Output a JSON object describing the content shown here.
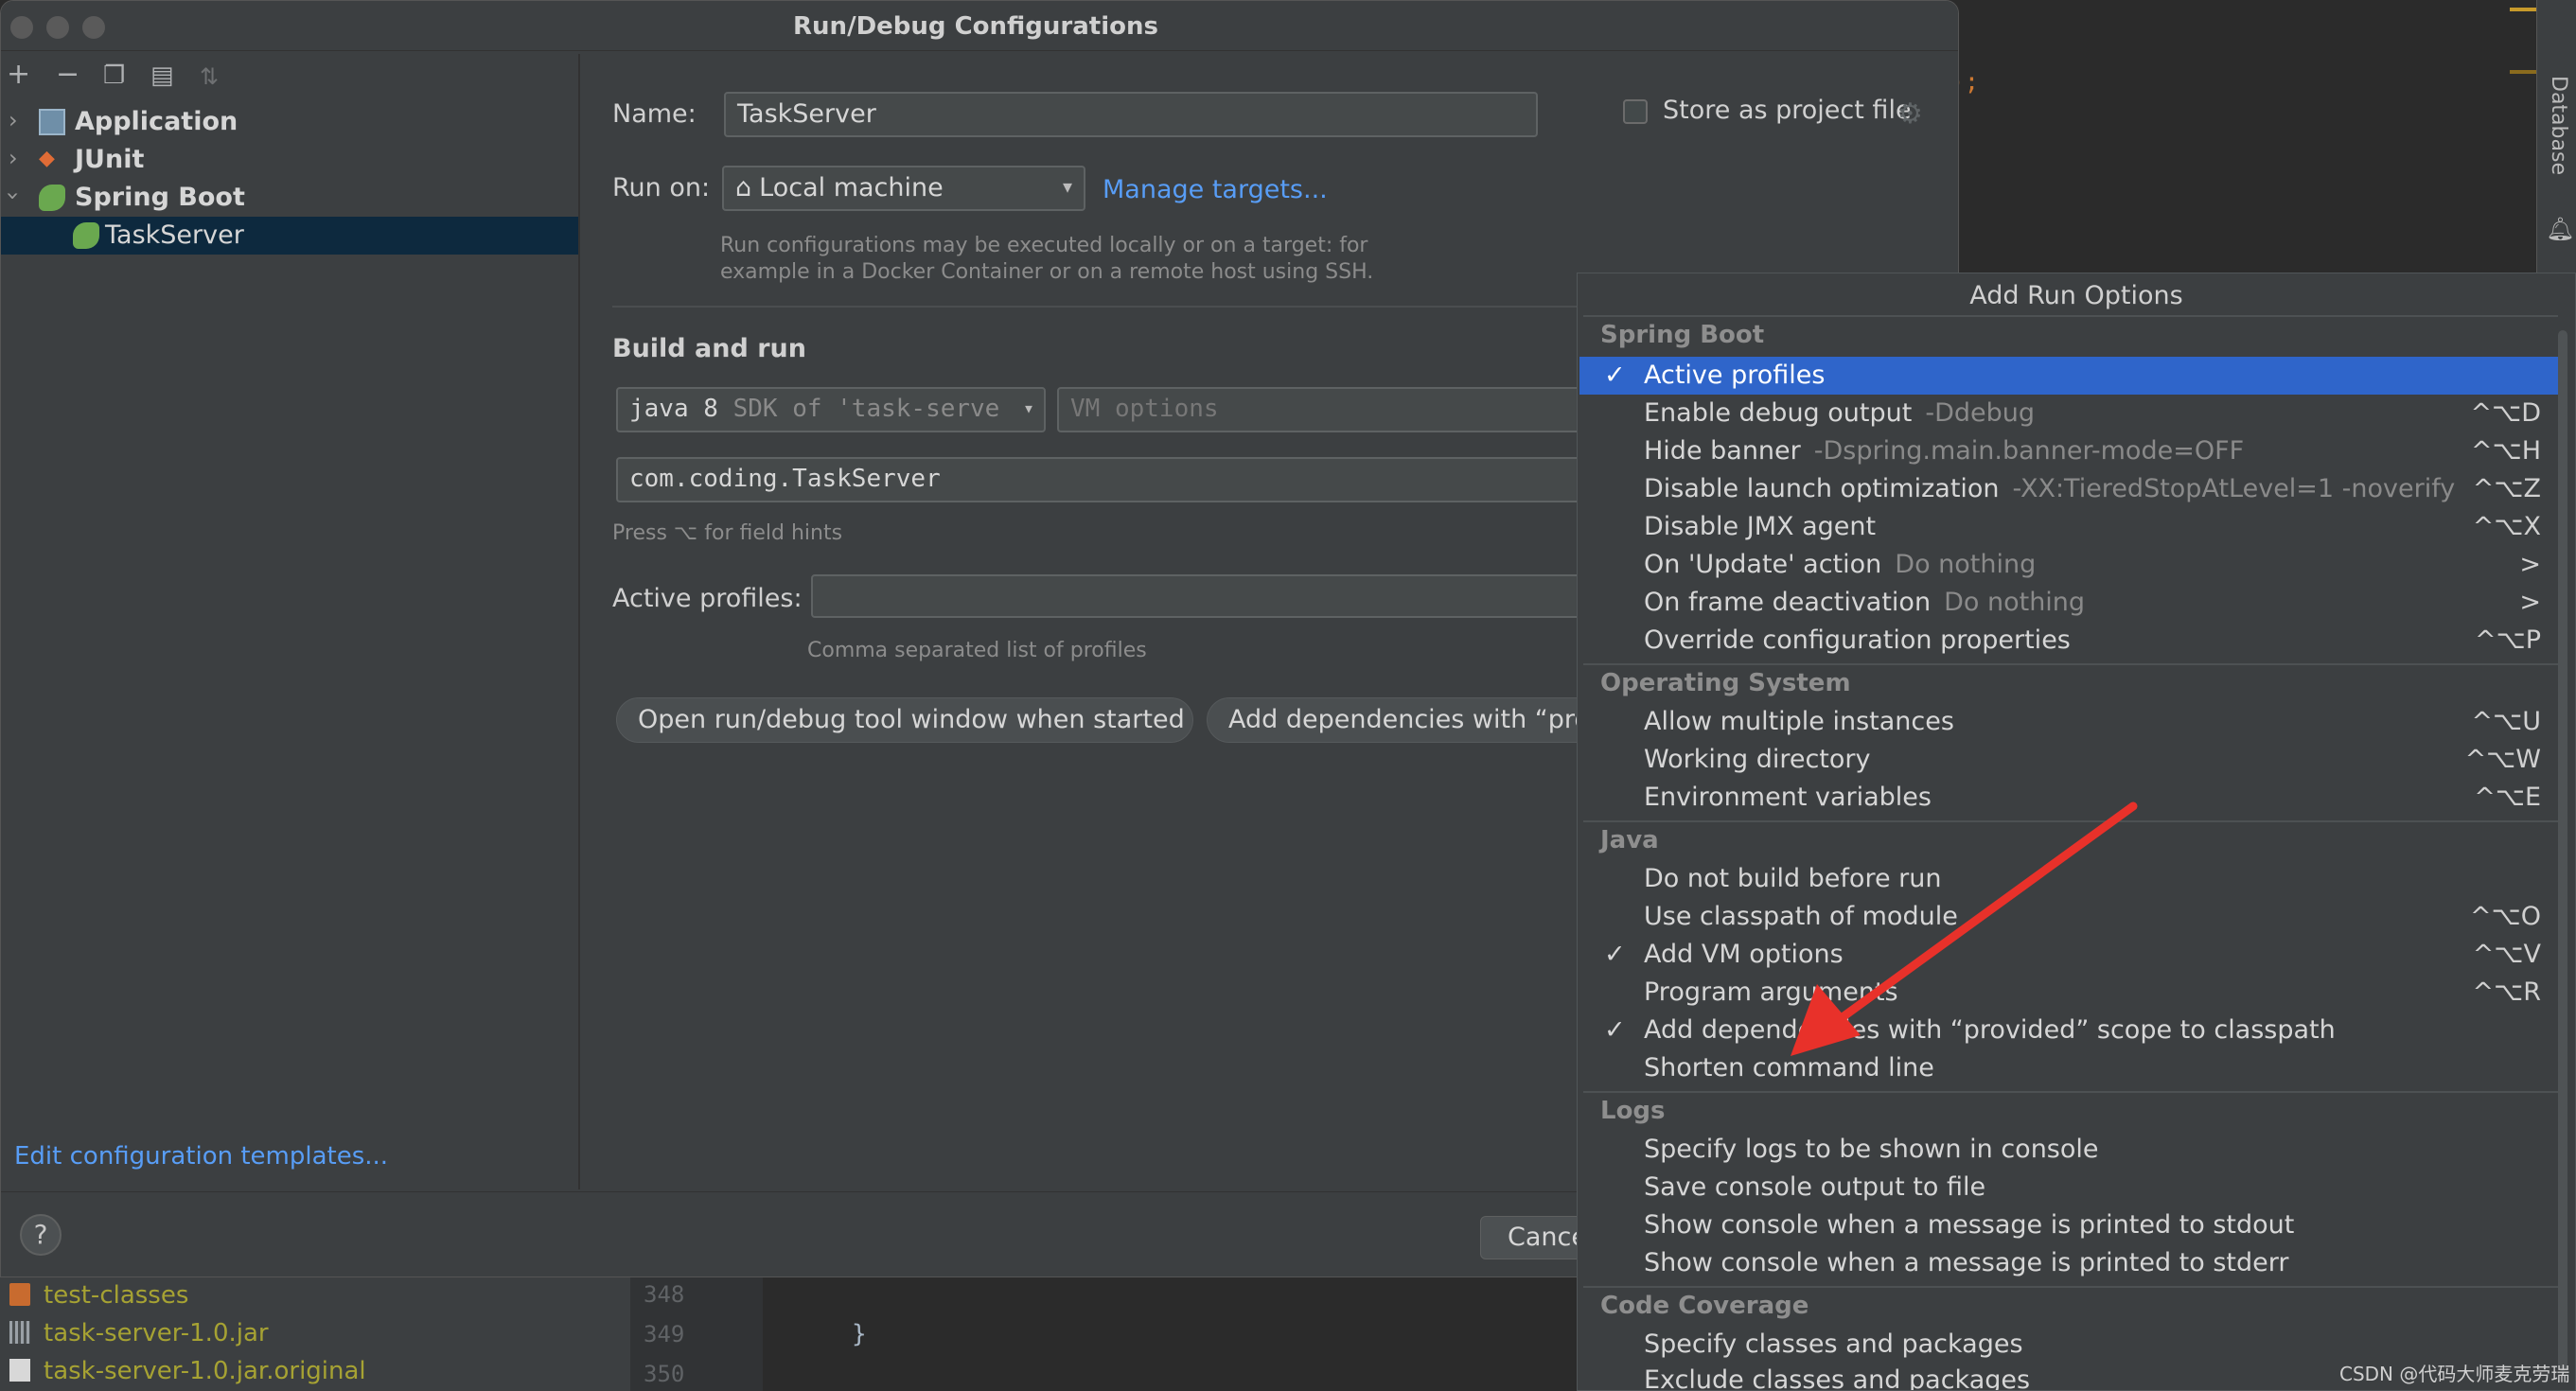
{
  "dialog": {
    "title": "Run/Debug Configurations",
    "tree": [
      {
        "label": "Application"
      },
      {
        "label": "JUnit"
      },
      {
        "label": "Spring Boot"
      },
      {
        "label": "TaskServer"
      }
    ],
    "edit_templates": "Edit configuration templates...",
    "help": "?",
    "cancel": "Cancel"
  },
  "form": {
    "name_label": "Name:",
    "name_value": "TaskServer",
    "store_label": "Store as project file",
    "run_on_label": "Run on:",
    "run_on_value": "Local machine",
    "manage_targets": "Manage targets...",
    "run_hint_1": "Run configurations may be executed locally or on a target: for",
    "run_hint_2": "example in a Docker Container or on a remote host using SSH.",
    "build_title": "Build and run",
    "sdk_value": "java 8",
    "sdk_suffix": "SDK of 'task-serve",
    "vm_placeholder": "VM options",
    "main_class": "com.coding.TaskServer",
    "field_hint": "Press ⌥ for field hints",
    "profiles_label": "Active profiles:",
    "profiles_hint": "Comma separated list of profiles",
    "chip1": "Open run/debug tool window when started",
    "chip2": "Add dependencies with “provi"
  },
  "popup": {
    "title": "Add Run Options",
    "groups": {
      "spring": "Spring Boot",
      "os": "Operating System",
      "java": "Java",
      "logs": "Logs",
      "coverage": "Code Coverage"
    },
    "items": [
      {
        "label": "Active profiles",
        "checked": "✓",
        "sub": "",
        "shortcut": ""
      },
      {
        "label": "Enable debug output",
        "checked": "",
        "sub": "-Ddebug",
        "shortcut": "^⌥D"
      },
      {
        "label": "Hide banner",
        "checked": "",
        "sub": "-Dspring.main.banner-mode=OFF",
        "shortcut": "^⌥H"
      },
      {
        "label": "Disable launch optimization",
        "checked": "",
        "sub": "-XX:TieredStopAtLevel=1 -noverify",
        "shortcut": "^⌥Z"
      },
      {
        "label": "Disable JMX agent",
        "checked": "",
        "sub": "",
        "shortcut": "^⌥X"
      },
      {
        "label": "On 'Update' action",
        "checked": "",
        "sub": "Do nothing",
        "shortcut": ">"
      },
      {
        "label": "On frame deactivation",
        "checked": "",
        "sub": "Do nothing",
        "shortcut": ">"
      },
      {
        "label": "Override configuration properties",
        "checked": "",
        "sub": "",
        "shortcut": "^⌥P"
      },
      {
        "label": "Allow multiple instances",
        "checked": "",
        "sub": "",
        "shortcut": "^⌥U"
      },
      {
        "label": "Working directory",
        "checked": "",
        "sub": "",
        "shortcut": "^⌥W"
      },
      {
        "label": "Environment variables",
        "checked": "",
        "sub": "",
        "shortcut": "^⌥E"
      },
      {
        "label": "Do not build before run",
        "checked": "",
        "sub": "",
        "shortcut": ""
      },
      {
        "label": "Use classpath of module",
        "checked": "",
        "sub": "",
        "shortcut": "^⌥O"
      },
      {
        "label": "Add VM options",
        "checked": "✓",
        "sub": "",
        "shortcut": "^⌥V"
      },
      {
        "label": "Program arguments",
        "checked": "",
        "sub": "",
        "shortcut": "^⌥R"
      },
      {
        "label": "Add dependencies with “provided” scope to classpath",
        "checked": "✓",
        "sub": "",
        "shortcut": ""
      },
      {
        "label": "Shorten command line",
        "checked": "",
        "sub": "",
        "shortcut": ""
      },
      {
        "label": "Specify logs to be shown in console",
        "checked": "",
        "sub": "",
        "shortcut": ""
      },
      {
        "label": "Save console output to file",
        "checked": "",
        "sub": "",
        "shortcut": ""
      },
      {
        "label": "Show console when a message is printed to stdout",
        "checked": "",
        "sub": "",
        "shortcut": ""
      },
      {
        "label": "Show console when a message is printed to stderr",
        "checked": "",
        "sub": "",
        "shortcut": ""
      },
      {
        "label": "Specify classes and packages",
        "checked": "",
        "sub": "",
        "shortcut": ""
      },
      {
        "label": "Exclude classes and packages",
        "checked": "",
        "sub": "",
        "shortcut": ""
      }
    ]
  },
  "ide": {
    "code_fragment": ");",
    "database_tab": "Database",
    "project_files": [
      "test-classes",
      "task-server-1.0.jar",
      "task-server-1.0.jar.original"
    ],
    "line_numbers": [
      "348",
      "349",
      "350"
    ],
    "brace": "}"
  },
  "watermark": "CSDN @代码大师麦克劳瑞",
  "colors": {
    "selection": "#2f65ca",
    "link": "#589df6",
    "annotation_arrow": "#e8312a"
  }
}
